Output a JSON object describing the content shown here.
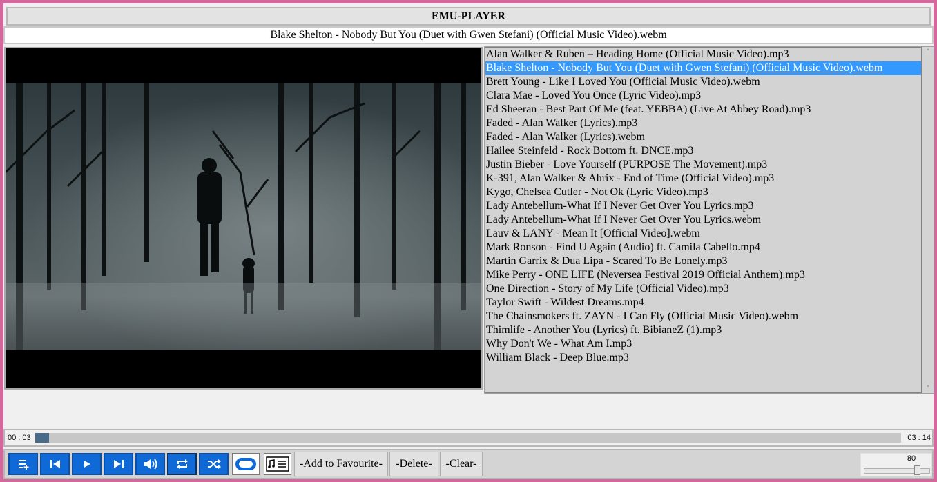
{
  "window": {
    "title": "EMU-PLAYER"
  },
  "now_playing": "Blake Shelton - Nobody But You (Duet with Gwen Stefani) (Official Music Video).webm",
  "playlist": {
    "selected_index": 1,
    "items": [
      "Alan Walker & Ruben – Heading Home (Official Music Video).mp3",
      "Blake Shelton - Nobody But You (Duet with Gwen Stefani) (Official Music Video).webm",
      "Brett Young - Like I Loved You (Official Music Video).webm",
      "Clara Mae - Loved You Once (Lyric Video).mp3",
      "Ed Sheeran - Best Part Of Me (feat. YEBBA) (Live At Abbey Road).mp3",
      "Faded - Alan Walker (Lyrics).mp3",
      "Faded - Alan Walker (Lyrics).webm",
      "Hailee Steinfeld - Rock Bottom ft. DNCE.mp3",
      "Justin Bieber - Love Yourself (PURPOSE  The Movement).mp3",
      "K-391, Alan Walker & Ahrix - End of Time (Official Video).mp3",
      "Kygo, Chelsea Cutler - Not Ok (Lyric Video).mp3",
      "Lady Antebellum-What If I Never Get Over You Lyrics.mp3",
      "Lady Antebellum-What If I Never Get Over You Lyrics.webm",
      "Lauv & LANY - Mean It [Official Video].webm",
      "Mark Ronson - Find U Again (Audio) ft. Camila Cabello.mp4",
      "Martin Garrix & Dua Lipa - Scared To Be Lonely.mp3",
      "Mike Perry - ONE LIFE (Neversea Festival 2019 Official Anthem).mp3",
      "One Direction - Story of My Life (Official Video).mp3",
      "Taylor Swift - Wildest Dreams.mp4",
      "The Chainsmokers ft. ZAYN - I Can Fly (Official Music Video).webm",
      "Thimlife - Another You (Lyrics) ft. BibianeZ (1).mp3",
      "Why Don't We - What Am I.mp3",
      "William Black - Deep Blue.mp3"
    ]
  },
  "progress": {
    "elapsed": "00 : 03",
    "total": "03 : 14",
    "fraction": 0.016
  },
  "controls": {
    "icons": [
      "add-to-playlist-icon",
      "previous-icon",
      "play-icon",
      "next-icon",
      "volume-icon",
      "repeat-icon",
      "shuffle-icon",
      "stop-icon",
      "playlist-view-icon"
    ],
    "add_favourite_label": "-Add to Favourite-",
    "delete_label": "-Delete-",
    "clear_label": "-Clear-"
  },
  "volume": {
    "value": "80",
    "fraction": 0.8
  },
  "colors": {
    "border": "#d4679b",
    "button_blue": "#0f6ad8",
    "selection": "#3399ff",
    "progress_fill": "#4a6a8a"
  }
}
